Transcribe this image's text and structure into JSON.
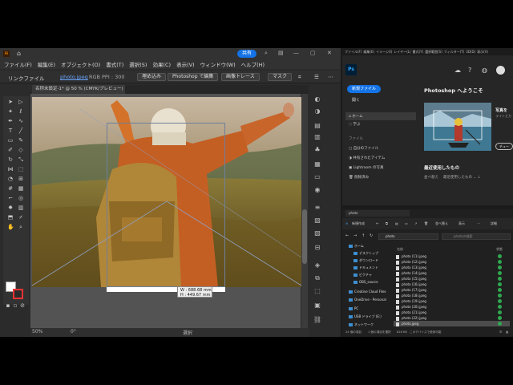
{
  "illustrator": {
    "share": "共有",
    "menu": [
      "ファイル(F)",
      "編集(E)",
      "オブジェクト(O)",
      "書式(T)",
      "選択(S)",
      "効果(C)",
      "表示(V)",
      "ウィンドウ(W)",
      "ヘルプ(H)"
    ],
    "control": {
      "linked_file": "リンクファイル",
      "file_name": "photo.jpeg",
      "color_info": "RGB",
      "ppi": "PPI : 300",
      "embed": "埋め込み",
      "edit_ps": "Photoshop で編集",
      "trace": "画像トレース",
      "mask": "マスク"
    },
    "doc_tab": "名称未設定-1* @ 50 % (CMYK/プレビュー)",
    "dims": {
      "w": "W : 688.68 mm",
      "h": "H : 449.67 mm"
    },
    "status": {
      "zoom": "50%",
      "angle": "0°",
      "mode": "選択"
    }
  },
  "photoshop": {
    "menu": [
      "ファイル(F)",
      "編集(E)",
      "イメージ(I)",
      "レイヤー(L)",
      "書式(Y)",
      "選択範囲(S)",
      "フィルター(T)",
      "3D(D)",
      "表示(V)"
    ],
    "logo": "Ps",
    "new_file": "新規ファイル",
    "open": "開く",
    "nav_home": "ホーム",
    "nav_learn": "学ぶ",
    "files_section": "ファイル",
    "nav_items": [
      "自分のファイル",
      "共有されたアイテム",
      "Lightroom の写真",
      "削除済み"
    ],
    "welcome": "Photoshop へようこそ",
    "thumb_title": "写真を",
    "thumb_sub": "ライトとカ",
    "try_btn": "チュー",
    "recent": "最近使用したもの",
    "sort_label": "並べ替え",
    "sort_value": "最近使用したもの"
  },
  "explorer": {
    "tab": "photo",
    "toolbar": {
      "new": "新規作成",
      "sort": "並べ替え",
      "view": "表示",
      "details": "詳細"
    },
    "address": "photo",
    "search_placeholder": "photoの検索",
    "nav_items": [
      "ホーム",
      "デスクトップ",
      "ダウンロード",
      "ドキュメント",
      "ピクチャ",
      "OBS_source",
      "Creative Cloud Files",
      "OneDrive - Personal",
      "PC",
      "USB ドライブ (E:)",
      "ネットワーク"
    ],
    "col_name": "名前",
    "col_status": "状態",
    "files": [
      "photo (11).jpeg",
      "photo (12).jpeg",
      "photo (13).jpeg",
      "photo (14).jpeg",
      "photo (15).jpeg",
      "photo (16).jpeg",
      "photo (17).jpeg",
      "photo (18).jpeg",
      "photo (19).jpeg",
      "photo (20).jpeg",
      "photo (21).jpeg",
      "photo (22).jpeg",
      "photo.jpeg"
    ],
    "status": {
      "count": "24 個の項目",
      "selected": "1 個の項目を選択",
      "size": "826 KB",
      "cloud": "このデバイスで使用可能"
    }
  }
}
